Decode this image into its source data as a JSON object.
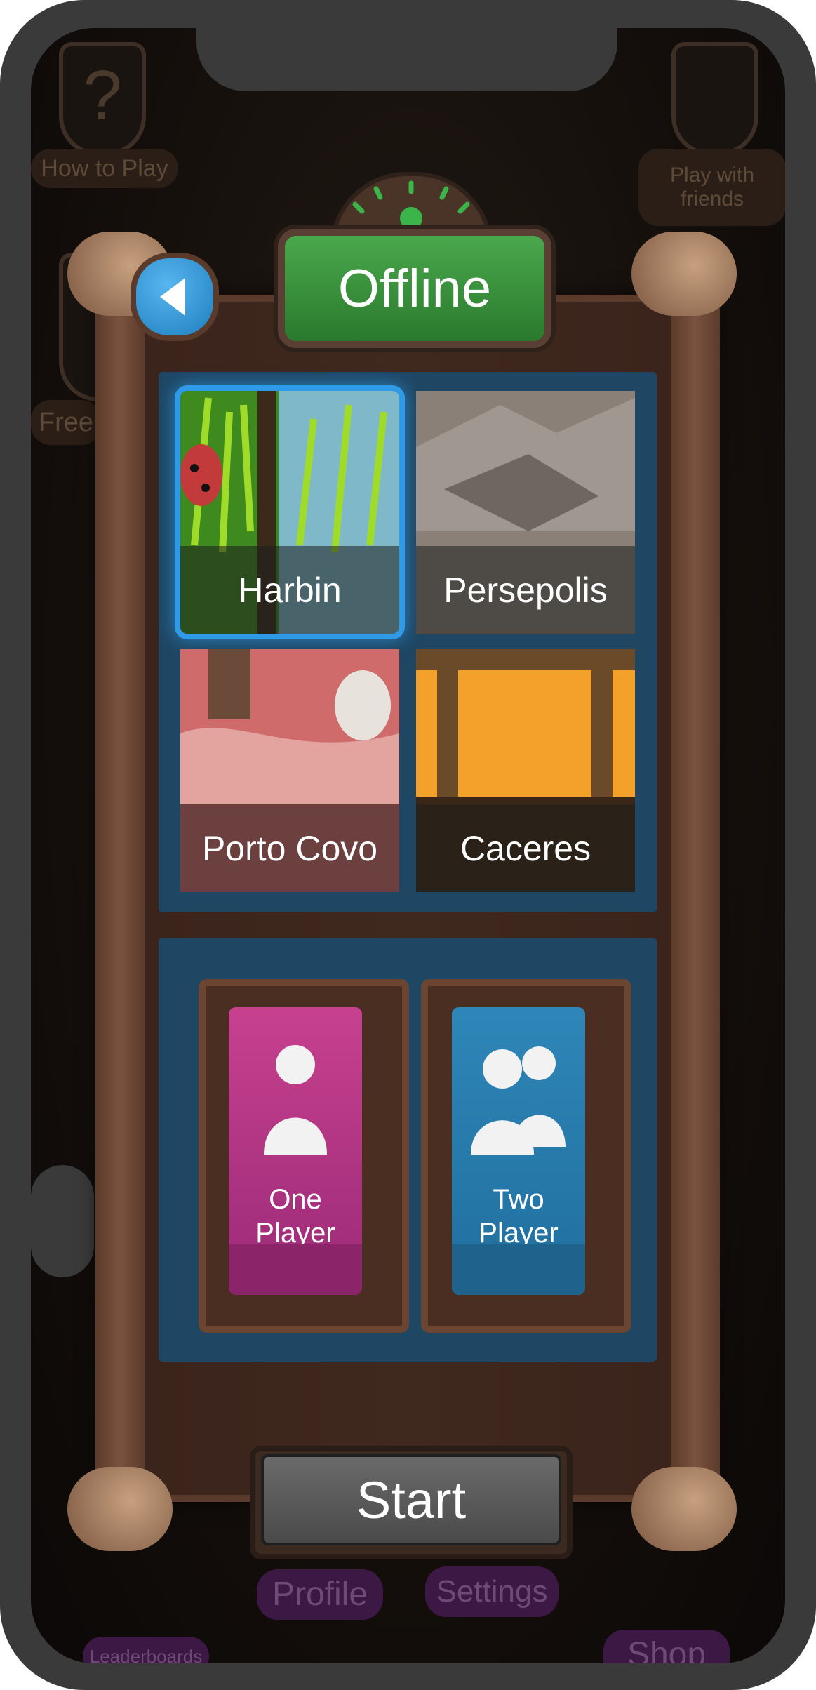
{
  "background": {
    "how_to_play": "How to Play",
    "play_with_friends": "Play with friends",
    "free": "Free",
    "leaderboards": "Leaderboards",
    "profile": "Profile",
    "settings": "Settings",
    "shop": "Shop"
  },
  "header": {
    "title": "Offline"
  },
  "maps": [
    {
      "name": "Harbin",
      "selected": true
    },
    {
      "name": "Persepolis",
      "selected": false
    },
    {
      "name": "Porto Covo",
      "selected": false
    },
    {
      "name": "Caceres",
      "selected": false
    }
  ],
  "modes": [
    {
      "label_line1": "One",
      "label_line2": "Player",
      "color": "#b0327f"
    },
    {
      "label_line1": "Two",
      "label_line2": "Player",
      "color": "#2a7fae"
    }
  ],
  "start_label": "Start",
  "colors": {
    "selection": "#2f9be8",
    "title_green": "#3a9a3d",
    "panel_blue": "#1f4764"
  }
}
